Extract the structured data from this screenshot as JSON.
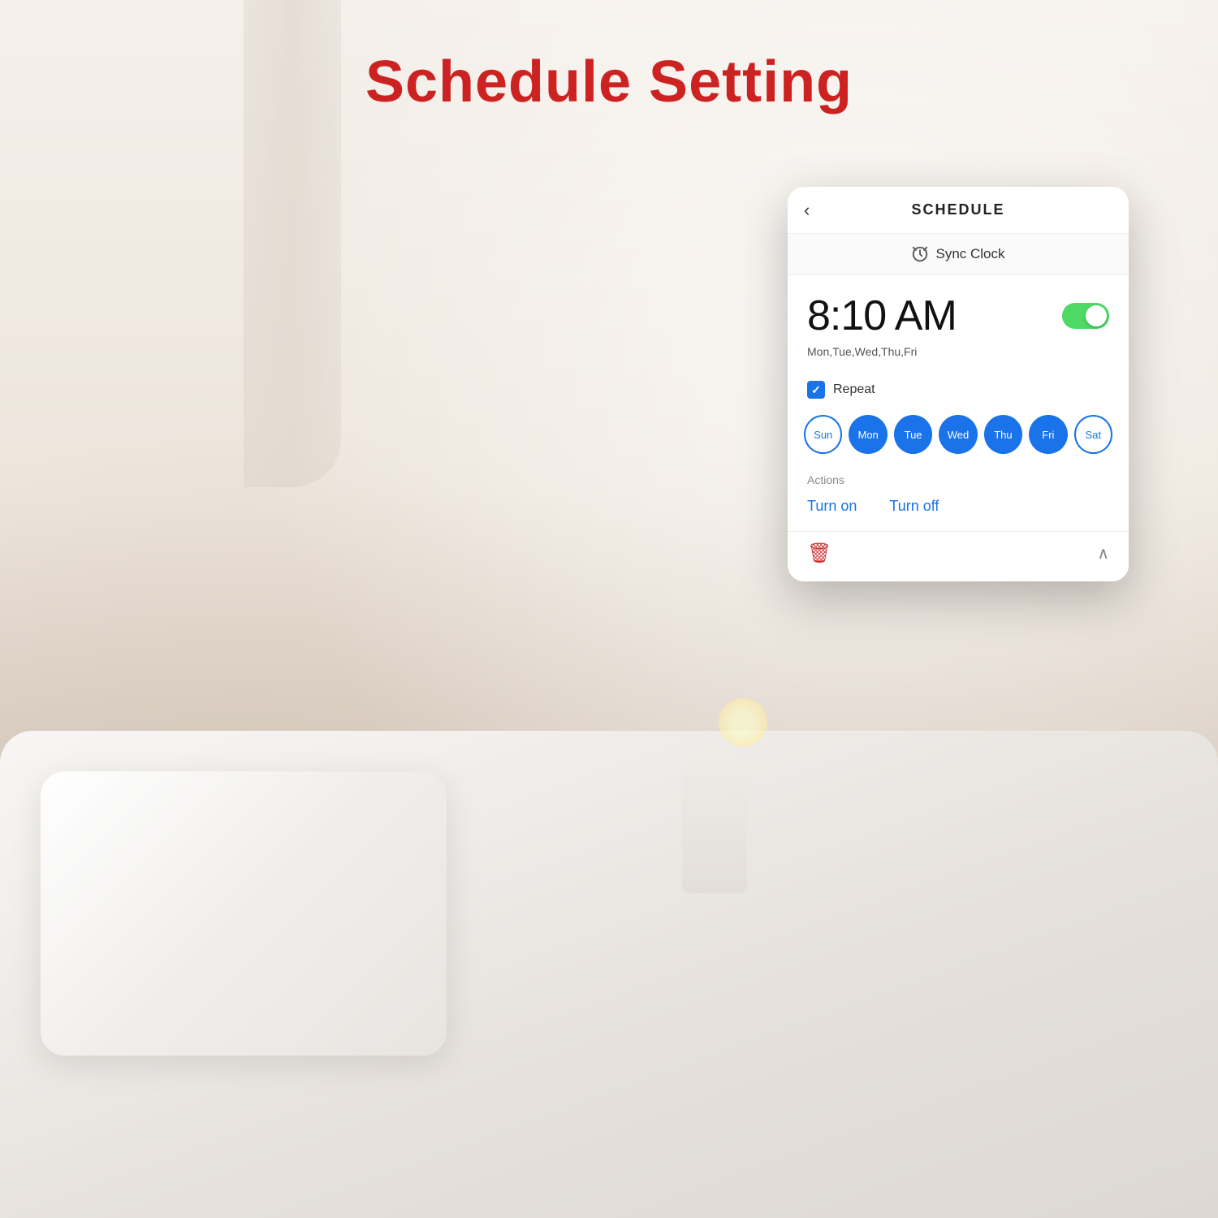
{
  "page": {
    "title": "Schedule Setting"
  },
  "header": {
    "back_label": "‹",
    "title": "SCHEDULE"
  },
  "sync_clock": {
    "label": "Sync Clock",
    "icon": "clock-sync-icon"
  },
  "schedule": {
    "time": "8:10 AM",
    "days_text": "Mon,Tue,Wed,Thu,Fri",
    "toggle_on": true,
    "repeat_label": "Repeat",
    "repeat_checked": true
  },
  "days": [
    {
      "label": "Sun",
      "active": false
    },
    {
      "label": "Mon",
      "active": true
    },
    {
      "label": "Tue",
      "active": true
    },
    {
      "label": "Wed",
      "active": true
    },
    {
      "label": "Thu",
      "active": true
    },
    {
      "label": "Fri",
      "active": true
    },
    {
      "label": "Sat",
      "active": false
    }
  ],
  "actions": {
    "label": "Actions",
    "turn_on": "Turn on",
    "turn_off": "Turn off"
  },
  "colors": {
    "accent_blue": "#1a73e8",
    "toggle_green": "#4cd964",
    "title_red": "#cc2222",
    "trash_red": "#cc3333"
  }
}
